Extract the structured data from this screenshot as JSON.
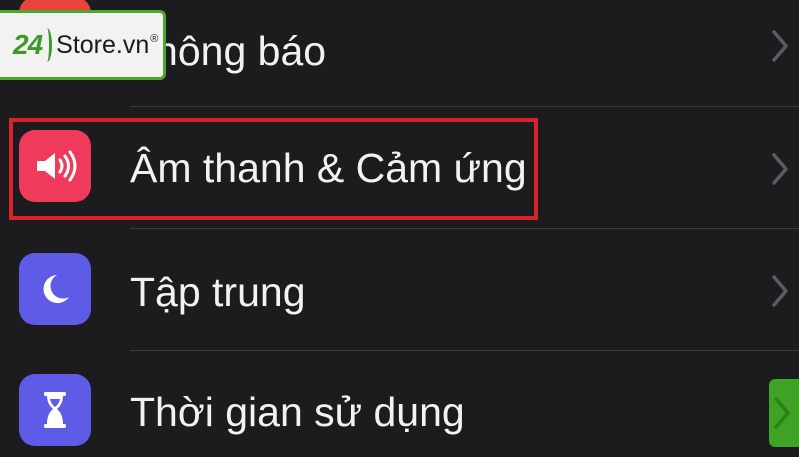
{
  "watermark": {
    "number": "24",
    "text": "Store.vn",
    "registered": "®",
    "accent": "#3c9a2a"
  },
  "settings": {
    "items": [
      {
        "label": "Thông báo",
        "icon": "bell-icon",
        "icon_color": "#e8453c"
      },
      {
        "label": "Âm thanh & Cảm ứng",
        "icon": "speaker-icon",
        "icon_color": "#f03a5b",
        "highlighted": true
      },
      {
        "label": "Tập trung",
        "icon": "moon-icon",
        "icon_color": "#5e5ce6"
      },
      {
        "label": "Thời gian sử dụng",
        "icon": "hourglass-icon",
        "icon_color": "#5e5ce6"
      }
    ]
  },
  "colors": {
    "background": "#1c1c1e",
    "divider": "#3a3a3c",
    "highlight": "#d8232a"
  }
}
